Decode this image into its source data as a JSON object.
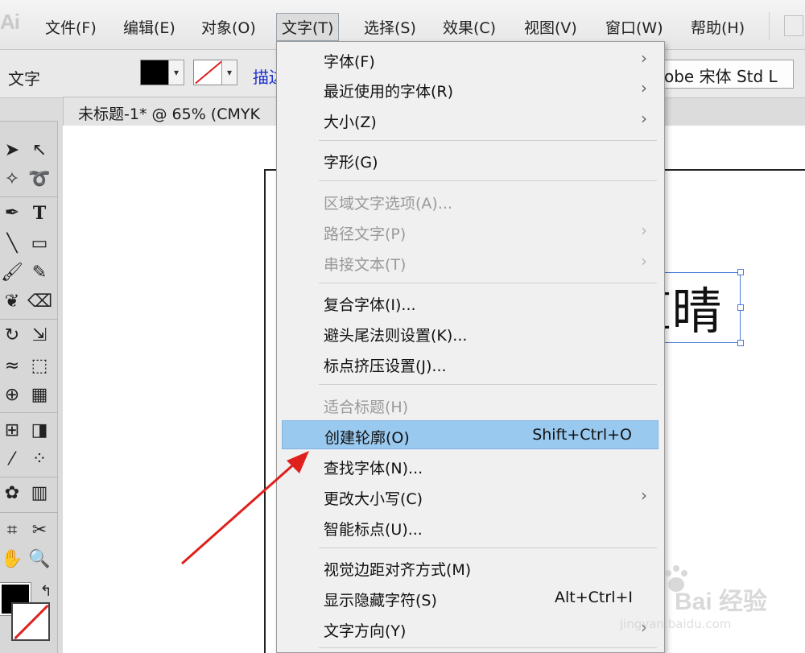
{
  "app": {
    "logo_text": "Ai"
  },
  "menubar": {
    "items": [
      {
        "label": "文件(F)"
      },
      {
        "label": "编辑(E)"
      },
      {
        "label": "对象(O)"
      },
      {
        "label": "文字(T)",
        "active": true
      },
      {
        "label": "选择(S)"
      },
      {
        "label": "效果(C)"
      },
      {
        "label": "视图(V)"
      },
      {
        "label": "窗口(W)"
      },
      {
        "label": "帮助(H)"
      }
    ]
  },
  "controlbar": {
    "tool_label": "文字",
    "fill_color": "#000000",
    "stroke_color": "none",
    "stroke_link": "描边",
    "font_value": "obe 宋体 Std L"
  },
  "document": {
    "tab_title": "未标题-1* @ 65% (CMYK",
    "artboard_text": "I晴"
  },
  "tools": [
    "selection-tool",
    "direct-selection-tool",
    "magic-wand-tool",
    "lasso-tool",
    "pen-tool",
    "type-tool",
    "line-tool",
    "rectangle-tool",
    "paintbrush-tool",
    "pencil-tool",
    "blob-brush-tool",
    "eraser-tool",
    "rotate-tool",
    "scale-tool",
    "warp-tool",
    "free-transform-tool",
    "shape-builder-tool",
    "perspective-grid-tool",
    "mesh-tool",
    "gradient-tool",
    "eyedropper-tool",
    "blend-tool",
    "symbol-sprayer-tool",
    "column-graph-tool",
    "artboard-tool",
    "slice-tool",
    "hand-tool",
    "zoom-tool"
  ],
  "dropdown": {
    "items": [
      {
        "label": "字体(F)",
        "shortcut": "",
        "submenu": true,
        "disabled": false
      },
      {
        "label": "最近使用的字体(R)",
        "shortcut": "",
        "submenu": true,
        "disabled": false
      },
      {
        "label": "大小(Z)",
        "shortcut": "",
        "submenu": true,
        "disabled": false
      },
      {
        "label": "字形(G)",
        "shortcut": "",
        "submenu": false,
        "disabled": false
      },
      {
        "label": "区域文字选项(A)...",
        "shortcut": "",
        "submenu": false,
        "disabled": true
      },
      {
        "label": "路径文字(P)",
        "shortcut": "",
        "submenu": true,
        "disabled": true
      },
      {
        "label": "串接文本(T)",
        "shortcut": "",
        "submenu": true,
        "disabled": true
      },
      {
        "label": "复合字体(I)...",
        "shortcut": "",
        "submenu": false,
        "disabled": false
      },
      {
        "label": "避头尾法则设置(K)...",
        "shortcut": "",
        "submenu": false,
        "disabled": false
      },
      {
        "label": "标点挤压设置(J)...",
        "shortcut": "",
        "submenu": false,
        "disabled": false
      },
      {
        "label": "适合标题(H)",
        "shortcut": "",
        "submenu": false,
        "disabled": true
      },
      {
        "label": "创建轮廓(O)",
        "shortcut": "Shift+Ctrl+O",
        "submenu": false,
        "disabled": false,
        "highlighted": true
      },
      {
        "label": "查找字体(N)...",
        "shortcut": "",
        "submenu": false,
        "disabled": false
      },
      {
        "label": "更改大小写(C)",
        "shortcut": "",
        "submenu": true,
        "disabled": false
      },
      {
        "label": "智能标点(U)...",
        "shortcut": "",
        "submenu": false,
        "disabled": false
      },
      {
        "label": "视觉边距对齐方式(M)",
        "shortcut": "",
        "submenu": false,
        "disabled": false
      },
      {
        "label": "显示隐藏字符(S)",
        "shortcut": "Alt+Ctrl+I",
        "submenu": false,
        "disabled": false
      },
      {
        "label": "文字方向(Y)",
        "shortcut": "",
        "submenu": true,
        "disabled": false
      }
    ]
  },
  "annotation": {
    "arrow_color": "#e0201c"
  },
  "watermark": {
    "brand": "Bai 经验",
    "url": "jingyan.baidu.com"
  },
  "colors": {
    "highlight": "#99c9ef",
    "selection": "#4a7bd6",
    "link": "#1a2fd0"
  }
}
